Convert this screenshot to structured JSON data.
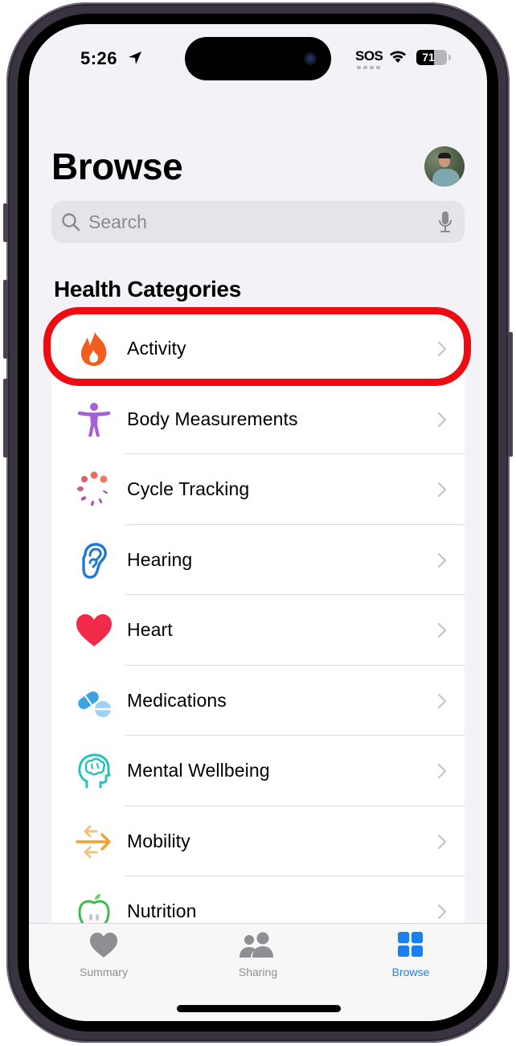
{
  "status_bar": {
    "time": "5:26",
    "carrier": "SOS",
    "battery_percent": 71,
    "battery_label": "71",
    "icons": [
      "location-arrow-icon",
      "wifi-icon",
      "battery-icon"
    ]
  },
  "header": {
    "title": "Browse",
    "avatar": "profile-photo"
  },
  "search": {
    "placeholder": "Search",
    "value": ""
  },
  "section": {
    "title": "Health Categories"
  },
  "categories": [
    {
      "label": "Activity",
      "icon": "flame-icon",
      "color": "#f25c1c",
      "highlighted": true
    },
    {
      "label": "Body Measurements",
      "icon": "figure-icon",
      "color": "#a65fd6"
    },
    {
      "label": "Cycle Tracking",
      "icon": "cycle-dots-icon",
      "color": "#e8675c"
    },
    {
      "label": "Hearing",
      "icon": "ear-icon",
      "color": "#1d78d6"
    },
    {
      "label": "Heart",
      "icon": "heart-icon",
      "color": "#f22a4a"
    },
    {
      "label": "Medications",
      "icon": "pills-icon",
      "color": "#3ba4e0"
    },
    {
      "label": "Mental Wellbeing",
      "icon": "head-brain-icon",
      "color": "#27c2b8"
    },
    {
      "label": "Mobility",
      "icon": "arrows-icon",
      "color": "#f0a232"
    },
    {
      "label": "Nutrition",
      "icon": "apple-icon",
      "color": "#3dbb52"
    }
  ],
  "annotation": {
    "highlight_color": "#ec0c12",
    "target": "Activity"
  },
  "tab_bar": {
    "tabs": [
      {
        "label": "Summary",
        "icon": "heart-icon",
        "active": false
      },
      {
        "label": "Sharing",
        "icon": "people-icon",
        "active": false
      },
      {
        "label": "Browse",
        "icon": "grid-icon",
        "active": true
      }
    ],
    "active_color": "#1a7ff0",
    "inactive_color": "#8e8e93"
  }
}
